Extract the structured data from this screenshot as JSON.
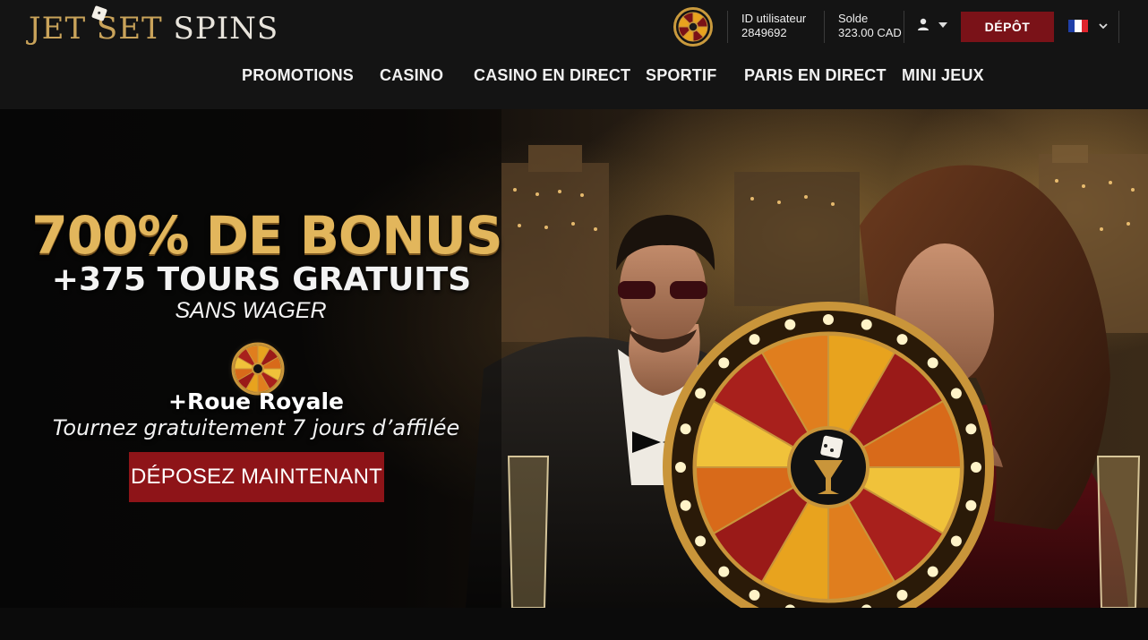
{
  "brand": {
    "logo_part1": "JET SET",
    "logo_part2": "SPINS"
  },
  "header": {
    "user_id_label": "ID utilisateur",
    "user_id_value": "2849692",
    "balance_label": "Solde",
    "balance_value": "323.00 CAD",
    "deposit_label": "DÉPÔT",
    "language": "fr",
    "icons": {
      "account": "user-icon",
      "wheel": "prize-wheel-icon",
      "flag": "france-flag-icon"
    }
  },
  "nav": {
    "items": [
      {
        "label": "PROMOTIONS"
      },
      {
        "label": "CASINO"
      },
      {
        "label": "CASINO EN DIRECT"
      },
      {
        "label": "SPORTIF"
      },
      {
        "label": "PARIS EN DIRECT"
      },
      {
        "label": "MINI JEUX"
      }
    ]
  },
  "hero": {
    "headline": "700% DE BONUS",
    "subheadline": "+375 TOURS GRATUITS",
    "tagline": "SANS WAGER",
    "wheel_title": "+Roue Royale",
    "wheel_text": "Tournez gratuitement 7 jours d’affilée",
    "cta_label": "DÉPOSEZ MAINTENANT"
  },
  "colors": {
    "header_bg": "#141414",
    "accent_red": "#8e1418",
    "gold": "#e2b65c",
    "flag_blue": "#1f3fa8",
    "flag_white": "#ffffff",
    "flag_red": "#e0242c"
  }
}
